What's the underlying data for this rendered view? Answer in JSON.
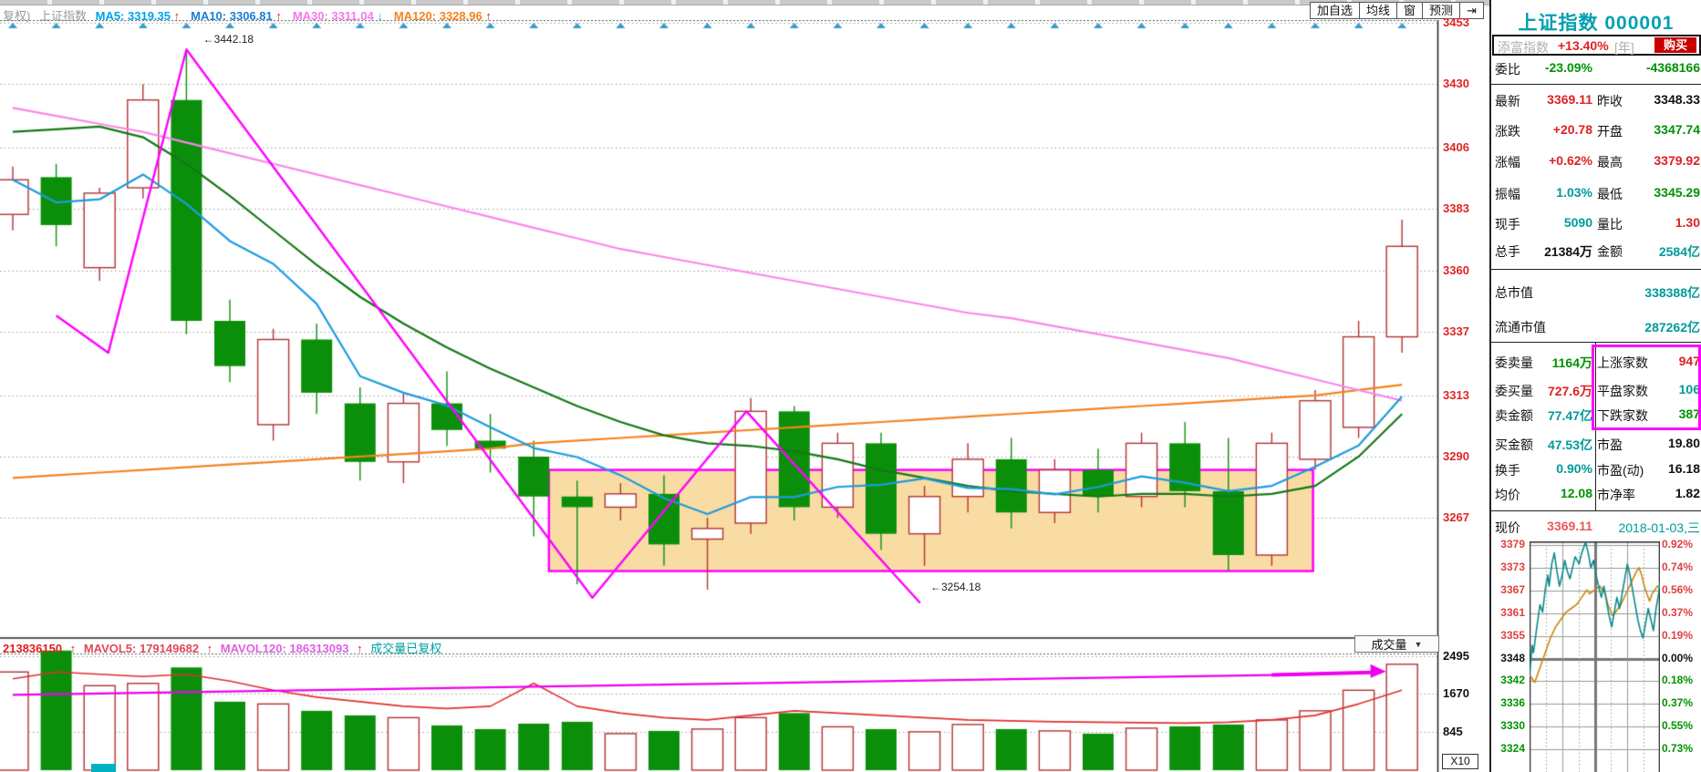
{
  "colors": {
    "accent_teal": "#009a9a",
    "up_red": "#e02020",
    "down_green": "#009200",
    "candle_up_border": "#b23232",
    "candle_down_fill": "#0b8f0b",
    "ma5_blue": "#1e9be0",
    "ma10_green": "#157815",
    "ma30_pink": "#fa86e9",
    "ma120_orange": "#f5821f",
    "zigzag_magenta": "#ff00ff",
    "box_fill": "#f8dca4",
    "axis_red": "#e02525",
    "mini_price_teal": "#0a8a8a",
    "mini_avg_orange": "#c8860b"
  },
  "header": {
    "left_prefix": "复权)",
    "index_name": "上证指数",
    "ma_items": [
      {
        "label": "MA5: 3319.35",
        "color": "#00a2e8",
        "arrow": "↑",
        "up": true
      },
      {
        "label": "MA10: 3306.81",
        "color": "#1b7ed0",
        "arrow": "↑",
        "up": true
      },
      {
        "label": "MA30: 3311.04",
        "color": "#f678e8",
        "arrow": "↓",
        "up": false
      },
      {
        "label": "MA120: 3328.96",
        "color": "#f5821f",
        "arrow": "↑",
        "up": true
      }
    ],
    "toolbar": [
      "加自选",
      "均线",
      "窗",
      "预测",
      "⇥"
    ]
  },
  "volume_header": {
    "current": "213836150",
    "arrow1": "↑",
    "mavol5": "MAVOL5: 179149682",
    "arrow2": "↑",
    "mavol120": "MAVOL120: 186313093",
    "arrow3": "↑",
    "note": "成交量已复权",
    "dropdown": "成交量",
    "dropdown_arrow": "▼"
  },
  "right_panel": {
    "title": "上证指数 000001",
    "fund": {
      "name": "添富指数",
      "change": "+13.40%",
      "unit": "[年]",
      "buy": "购买"
    },
    "rows": {
      "weibi": {
        "label": "委比",
        "value": "-23.09%",
        "extra": "-4368166"
      },
      "zuixin": {
        "l1": "最新",
        "v1": "3369.11",
        "l2": "昨收",
        "v2": "3348.33"
      },
      "zhangdie": {
        "l1": "涨跌",
        "v1": "+20.78",
        "l2": "开盘",
        "v2": "3347.74"
      },
      "zhangfu": {
        "l1": "涨幅",
        "v1": "+0.62%",
        "l2": "最高",
        "v2": "3379.92"
      },
      "zhenfu": {
        "l1": "振幅",
        "v1": "1.03%",
        "l2": "最低",
        "v2": "3345.29"
      },
      "xianshou": {
        "l1": "现手",
        "v1": "5090",
        "l2": "量比",
        "v2": "1.30"
      },
      "zongshou": {
        "l1": "总手",
        "v1": "21384",
        "u1": "万",
        "l2": "金额",
        "v2": "2584",
        "u2": "亿"
      },
      "zongshizhi": {
        "label": "总市值",
        "value": "338388",
        "unit": "亿"
      },
      "liutongshizhi": {
        "label": "流通市值",
        "value": "287262",
        "unit": "亿"
      },
      "wsell": {
        "l1": "委卖量",
        "v1": "1164",
        "u1": "万",
        "l2": "上涨家数",
        "v2": "947"
      },
      "wbuy": {
        "l1": "委买量",
        "v1": "727.6",
        "u1": "万",
        "l2": "平盘家数",
        "v2": "106"
      },
      "msell": {
        "l1": "卖金额",
        "v1": "77.47",
        "u1": "亿",
        "l2": "下跌家数",
        "v2": "387"
      },
      "mbuy": {
        "l1": "买金额",
        "v1": "47.53",
        "u1": "亿",
        "l2": "市盈",
        "v2": "19.80"
      },
      "huanshou": {
        "l1": "换手",
        "v1": "0.90%",
        "l2": "市盈(动)",
        "v2": "16.18"
      },
      "junjia": {
        "l1": "均价",
        "v1": "12.08",
        "l2": "市净率",
        "v2": "1.82"
      },
      "xianjia": {
        "label": "现价",
        "value": "3369.11",
        "date": "2018-01-03,三"
      }
    }
  },
  "chart_data": {
    "main": {
      "type": "candlestick",
      "y_axis": [
        3453,
        3430,
        3406,
        3383,
        3360,
        3337,
        3313,
        3290,
        3267
      ],
      "candles": [
        [
          3381,
          3399,
          3375,
          3394,
          2150
        ],
        [
          3395,
          3400,
          3369,
          3377,
          2620
        ],
        [
          3361,
          3391,
          3356,
          3389,
          1850
        ],
        [
          3391,
          3430,
          3387,
          3424,
          1900
        ],
        [
          3424,
          3442,
          3336,
          3341,
          2250
        ],
        [
          3341,
          3349,
          3318,
          3324,
          1500
        ],
        [
          3302,
          3338,
          3296,
          3334,
          1450
        ],
        [
          3334,
          3340,
          3306,
          3314,
          1300
        ],
        [
          3310,
          3316,
          3281,
          3288,
          1200
        ],
        [
          3288,
          3314,
          3280,
          3310,
          1150
        ],
        [
          3310,
          3322,
          3294,
          3300,
          980
        ],
        [
          3296,
          3306,
          3284,
          3293,
          900
        ],
        [
          3290,
          3296,
          3260,
          3275,
          1020
        ],
        [
          3275,
          3281,
          3242,
          3271,
          1060
        ],
        [
          3271,
          3280,
          3266,
          3276,
          800
        ],
        [
          3276,
          3283,
          3249,
          3257,
          860
        ],
        [
          3259,
          3267,
          3240,
          3263,
          900
        ],
        [
          3265,
          3312,
          3261,
          3307,
          1150
        ],
        [
          3307,
          3309,
          3266,
          3271,
          1250
        ],
        [
          3271,
          3299,
          3267,
          3295,
          950
        ],
        [
          3295,
          3299,
          3255,
          3261,
          900
        ],
        [
          3261,
          3279,
          3249,
          3275,
          840
        ],
        [
          3275,
          3295,
          3269,
          3289,
          1000
        ],
        [
          3289,
          3297,
          3263,
          3269,
          900
        ],
        [
          3269,
          3289,
          3265,
          3285,
          860
        ],
        [
          3285,
          3293,
          3269,
          3275,
          800
        ],
        [
          3275,
          3299,
          3271,
          3295,
          920
        ],
        [
          3295,
          3303,
          3271,
          3277,
          960
        ],
        [
          3277,
          3297,
          3247,
          3253,
          1000
        ],
        [
          3253,
          3299,
          3249,
          3295,
          1100
        ],
        [
          3289,
          3315,
          3285,
          3311,
          1300
        ],
        [
          3301,
          3341,
          3297,
          3335,
          1750
        ],
        [
          3335,
          3379,
          3329,
          3369,
          2320
        ]
      ],
      "ma10": [
        3412,
        3413,
        3414,
        3410,
        3400,
        3388,
        3375,
        3362,
        3350,
        3340,
        3331,
        3323,
        3316,
        3309,
        3303,
        3298,
        3295,
        3294,
        3292,
        3289,
        3285,
        3282,
        3279,
        3277,
        3276,
        3275,
        3276,
        3276,
        3275,
        3276,
        3279,
        3290,
        3306
      ],
      "ma30": [
        3421,
        3418,
        3415,
        3412,
        3408,
        3404,
        3400,
        3396,
        3392,
        3388,
        3384,
        3380,
        3376,
        3372,
        3368,
        3365,
        3362,
        3359,
        3356,
        3353,
        3350,
        3347,
        3344,
        3342,
        3339,
        3336,
        3333,
        3330,
        3327,
        3323,
        3319,
        3315,
        3311
      ],
      "ma120": [
        3282,
        3283,
        3284,
        3285,
        3286,
        3287,
        3288,
        3289,
        3290,
        3291,
        3292,
        3293,
        3295,
        3296,
        3297,
        3298,
        3299,
        3300,
        3301,
        3302,
        3303,
        3304,
        3305,
        3306,
        3307,
        3308,
        3309,
        3310,
        3311,
        3312,
        3313,
        3315,
        3317
      ],
      "zigzag": [
        [
          1.0,
          3343
        ],
        [
          2.2,
          3329
        ],
        [
          4.0,
          3443
        ],
        [
          13.35,
          3237
        ],
        [
          16.9,
          3307
        ],
        [
          20.9,
          3235
        ]
      ],
      "annotations": [
        {
          "text": "←3442.18",
          "i": 4.3,
          "p": 3447
        },
        {
          "text": "←3254.18",
          "i": 21.05,
          "p": 3241
        }
      ],
      "box": {
        "i1": 12.35,
        "i2": 29.95,
        "p1": 3285,
        "p2": 3247
      }
    },
    "volume": {
      "axis": [
        2495,
        1670,
        845
      ],
      "x10": "X10",
      "mavol5": [
        2000,
        2150,
        2100,
        2050,
        2100,
        1950,
        1750,
        1600,
        1500,
        1400,
        1350,
        1400,
        1900,
        1400,
        1250,
        1150,
        1100,
        1200,
        1300,
        1250,
        1200,
        1150,
        1100,
        1080,
        1060,
        1050,
        1040,
        1030,
        1050,
        1100,
        1200,
        1450,
        1750
      ],
      "mavol120": [
        1650,
        1665,
        1680,
        1695,
        1710,
        1725,
        1740,
        1755,
        1770,
        1785,
        1800,
        1815,
        1830,
        1845,
        1860,
        1875,
        1890,
        1905,
        1920,
        1935,
        1950,
        1965,
        1980,
        1995,
        2010,
        2025,
        2040,
        2055,
        2070,
        2085,
        2100,
        2120,
        2140
      ]
    },
    "mini": {
      "type": "line",
      "left_axis": [
        "3379",
        "3373",
        "3367",
        "3361",
        "3355",
        "3348",
        "3342",
        "3336",
        "3330",
        "3324"
      ],
      "right_axis": [
        "0.92%",
        "0.74%",
        "0.56%",
        "0.37%",
        "0.19%",
        "0.00%",
        "0.18%",
        "0.37%",
        "0.55%",
        "0.73%"
      ],
      "prev_close": 3348.33,
      "price": [
        [
          0,
          3344
        ],
        [
          0.02,
          3352
        ],
        [
          0.03,
          3350
        ],
        [
          0.06,
          3358
        ],
        [
          0.08,
          3363
        ],
        [
          0.1,
          3361
        ],
        [
          0.12,
          3367
        ],
        [
          0.14,
          3371
        ],
        [
          0.15,
          3368
        ],
        [
          0.17,
          3374
        ],
        [
          0.19,
          3377
        ],
        [
          0.21,
          3372
        ],
        [
          0.23,
          3368
        ],
        [
          0.25,
          3371
        ],
        [
          0.27,
          3375
        ],
        [
          0.29,
          3372
        ],
        [
          0.31,
          3370
        ],
        [
          0.33,
          3373
        ],
        [
          0.35,
          3376
        ],
        [
          0.38,
          3374
        ],
        [
          0.4,
          3377
        ],
        [
          0.43,
          3379.9
        ],
        [
          0.45,
          3377
        ],
        [
          0.47,
          3373
        ],
        [
          0.49,
          3375
        ],
        [
          0.51,
          3371
        ],
        [
          0.53,
          3368
        ],
        [
          0.55,
          3365
        ],
        [
          0.57,
          3368
        ],
        [
          0.59,
          3364
        ],
        [
          0.61,
          3360
        ],
        [
          0.63,
          3357
        ],
        [
          0.65,
          3361
        ],
        [
          0.67,
          3365
        ],
        [
          0.69,
          3362
        ],
        [
          0.71,
          3366
        ],
        [
          0.73,
          3370
        ],
        [
          0.75,
          3374
        ],
        [
          0.77,
          3371
        ],
        [
          0.79,
          3367
        ],
        [
          0.81,
          3363
        ],
        [
          0.83,
          3359
        ],
        [
          0.85,
          3356
        ],
        [
          0.87,
          3354
        ],
        [
          0.89,
          3358
        ],
        [
          0.91,
          3362
        ],
        [
          0.93,
          3359
        ],
        [
          0.95,
          3356
        ],
        [
          0.97,
          3362
        ],
        [
          0.99,
          3366
        ],
        [
          1.0,
          3369.1
        ]
      ],
      "avg": [
        [
          0,
          3344
        ],
        [
          0.04,
          3342
        ],
        [
          0.08,
          3346
        ],
        [
          0.12,
          3350
        ],
        [
          0.16,
          3354
        ],
        [
          0.2,
          3357
        ],
        [
          0.24,
          3359
        ],
        [
          0.28,
          3361
        ],
        [
          0.32,
          3362
        ],
        [
          0.36,
          3363
        ],
        [
          0.4,
          3365
        ],
        [
          0.44,
          3367
        ],
        [
          0.46,
          3366
        ],
        [
          0.5,
          3367
        ],
        [
          0.54,
          3368
        ],
        [
          0.58,
          3366
        ],
        [
          0.6,
          3363
        ],
        [
          0.64,
          3360
        ],
        [
          0.66,
          3361
        ],
        [
          0.7,
          3363
        ],
        [
          0.74,
          3366
        ],
        [
          0.78,
          3369
        ],
        [
          0.82,
          3372
        ],
        [
          0.84,
          3373
        ],
        [
          0.86,
          3371
        ],
        [
          0.88,
          3368
        ],
        [
          0.9,
          3366
        ],
        [
          0.92,
          3364
        ],
        [
          0.94,
          3366
        ],
        [
          0.96,
          3367
        ],
        [
          0.98,
          3368
        ],
        [
          1.0,
          3368
        ]
      ]
    }
  }
}
